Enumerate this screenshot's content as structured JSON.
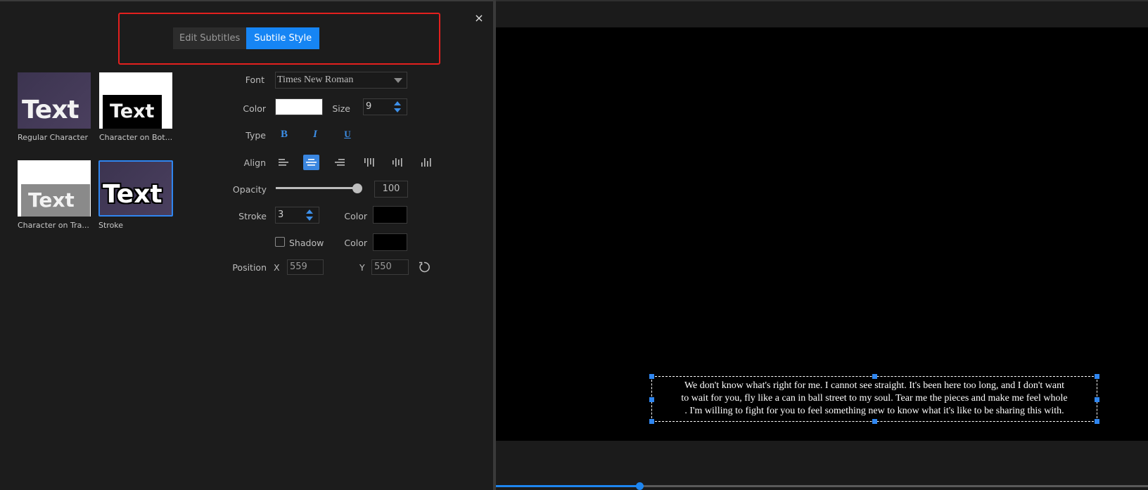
{
  "tabs": [
    {
      "label": "Edit Subtitles",
      "active": false
    },
    {
      "label": "Subtile Style",
      "active": true
    }
  ],
  "close_icon": "×",
  "presets": [
    {
      "name": "Regular Character",
      "label": "Regular Character",
      "preview_text": "Text",
      "selected": false
    },
    {
      "name": "Character on Bottom",
      "label": "Character on Bot...",
      "preview_text": "Text",
      "selected": false
    },
    {
      "name": "Character on Transparent",
      "label": "Character on Tra...",
      "preview_text": "Text",
      "selected": false
    },
    {
      "name": "Stroke",
      "label": "Stroke",
      "preview_text": "Text",
      "selected": true
    }
  ],
  "style": {
    "font_label": "Font",
    "font_value": "Times New Roman",
    "color_label": "Color",
    "color_value": "#ffffff",
    "size_label": "Size",
    "size_value": "9",
    "type_label": "Type",
    "type_bold": "B",
    "type_italic": "I",
    "type_underline": "U",
    "align_label": "Align",
    "align_options": [
      "left",
      "center",
      "right",
      "top",
      "middle",
      "bottom"
    ],
    "align_selected": "center",
    "opacity_label": "Opacity",
    "opacity_value": "100",
    "opacity_percent": 100,
    "stroke_label": "Stroke",
    "stroke_value": "3",
    "stroke_color_label": "Color",
    "stroke_color": "#000000",
    "shadow_label": "Shadow",
    "shadow_checked": false,
    "shadow_color_label": "Color",
    "shadow_color": "#000000",
    "position_label": "Position",
    "x_label": "X",
    "x_value": "559",
    "y_label": "Y",
    "y_value": "550"
  },
  "preview": {
    "subtitle_lines": [
      "We don't know what's right for me. I cannot see straight. It's been here too long, and I don't want",
      "to wait for you, fly like a can in ball street to my soul. Tear me the pieces and make me feel whole",
      ". I'm willing to fight for you to feel something new to know what it's like to be sharing this with."
    ],
    "progress_percent": 22
  },
  "colors": {
    "accent": "#1685f4",
    "highlight_box": "#e3201e"
  }
}
